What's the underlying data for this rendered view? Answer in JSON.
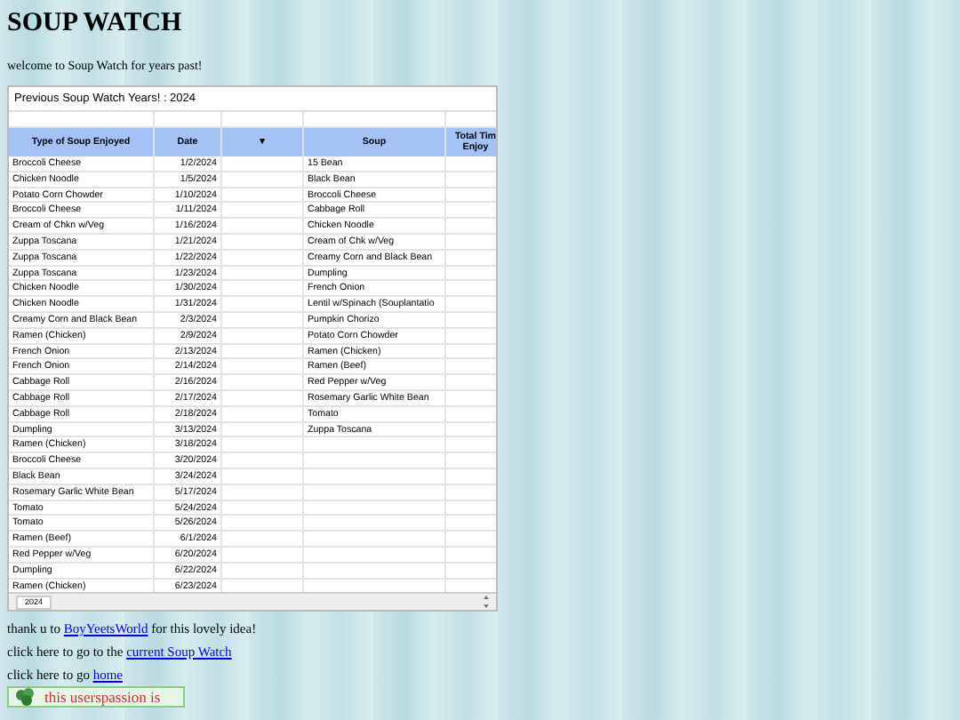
{
  "title": "SOUP WATCH",
  "welcome": "welcome to Soup Watch for years past!",
  "sheet": {
    "title": "Previous Soup Watch Years! : 2024",
    "columns": [
      "Type of Soup Enjoyed",
      "Date",
      "▼",
      "Soup",
      "Total Tim Enjoy"
    ],
    "rows": [
      {
        "type": "Broccoli Cheese",
        "date": "1/2/2024",
        "soup": "15 Bean"
      },
      {
        "type": "Chicken Noodle",
        "date": "1/5/2024",
        "soup": "Black Bean"
      },
      {
        "type": "Potato Corn Chowder",
        "date": "1/10/2024",
        "soup": "Broccoli Cheese"
      },
      {
        "type": "Broccoli Cheese",
        "date": "1/11/2024",
        "soup": "Cabbage Roll"
      },
      {
        "type": "Cream of Chkn w/Veg",
        "date": "1/16/2024",
        "soup": "Chicken Noodle"
      },
      {
        "type": "Zuppa Toscana",
        "date": "1/21/2024",
        "soup": "Cream of Chk w/Veg"
      },
      {
        "type": "Zuppa Toscana",
        "date": "1/22/2024",
        "soup": "Creamy Corn and Black Bean"
      },
      {
        "type": "Zuppa Toscana",
        "date": "1/23/2024",
        "soup": "Dumpling"
      },
      {
        "type": "Chicken Noodle",
        "date": "1/30/2024",
        "soup": "French Onion"
      },
      {
        "type": "Chicken Noodle",
        "date": "1/31/2024",
        "soup": "Lentil w/Spinach (Souplantatio"
      },
      {
        "type": "Creamy Corn and Black Bean",
        "date": "2/3/2024",
        "soup": "Pumpkin Chorizo"
      },
      {
        "type": "Ramen (Chicken)",
        "date": "2/9/2024",
        "soup": "Potato Corn Chowder"
      },
      {
        "type": "French Onion",
        "date": "2/13/2024",
        "soup": "Ramen (Chicken)"
      },
      {
        "type": "French Onion",
        "date": "2/14/2024",
        "soup": "Ramen (Beef)"
      },
      {
        "type": "Cabbage Roll",
        "date": "2/16/2024",
        "soup": "Red Pepper w/Veg"
      },
      {
        "type": "Cabbage Roll",
        "date": "2/17/2024",
        "soup": "Rosemary Garlic White Bean"
      },
      {
        "type": "Cabbage Roll",
        "date": "2/18/2024",
        "soup": "Tomato"
      },
      {
        "type": "Dumpling",
        "date": "3/13/2024",
        "soup": "Zuppa Toscana"
      },
      {
        "type": "Ramen (Chicken)",
        "date": "3/18/2024"
      },
      {
        "type": "Broccoli Cheese",
        "date": "3/20/2024"
      },
      {
        "type": "Black Bean",
        "date": "3/24/2024"
      },
      {
        "type": "Rosemary Garlic White Bean",
        "date": "5/17/2024"
      },
      {
        "type": "Tomato",
        "date": "5/24/2024"
      },
      {
        "type": "Tomato",
        "date": "5/26/2024"
      },
      {
        "type": "Ramen (Beef)",
        "date": "6/1/2024"
      },
      {
        "type": "Red Pepper w/Veg",
        "date": "6/20/2024"
      },
      {
        "type": "Dumpling",
        "date": "6/22/2024"
      },
      {
        "type": "Ramen (Chicken)",
        "date": "6/23/2024"
      }
    ],
    "tab": "2024"
  },
  "footer": [
    {
      "before": "thank u to ",
      "link": "BoyYeetsWorld",
      "after": " for this lovely idea!"
    },
    {
      "before": "click here to go to the ",
      "link": "current Soup Watch"
    },
    {
      "before": "click here to go ",
      "link": "home"
    }
  ],
  "badge": "this userspassion is"
}
